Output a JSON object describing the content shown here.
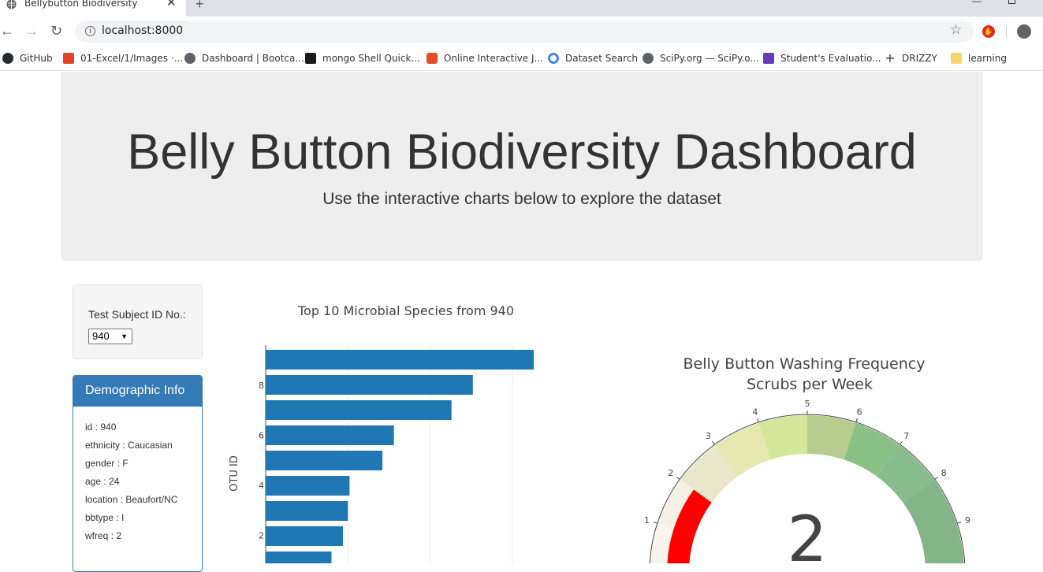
{
  "browser": {
    "tab_title": "Bellybutton Biodiversity",
    "tab_close": "✕",
    "new_tab": "+",
    "url": "localhost:8000",
    "bookmarks": [
      {
        "label": "GitHub",
        "icon": "github-icon",
        "color": "#24292e"
      },
      {
        "label": "01-Excel/1/Images ·...",
        "icon": "gitlab-icon",
        "color": "#e24329"
      },
      {
        "label": "Dashboard | Bootca...",
        "icon": "globe-icon",
        "color": "#5f6368"
      },
      {
        "label": "mongo Shell Quick...",
        "icon": "mongodb-icon",
        "color": "#13aa52"
      },
      {
        "label": "Online Interactive J...",
        "icon": "html5-icon",
        "color": "#e44d26"
      },
      {
        "label": "Dataset Search",
        "icon": "google-icon",
        "color": "#4285f4"
      },
      {
        "label": "SciPy.org — SciPy.o...",
        "icon": "globe-icon",
        "color": "#5f6368"
      },
      {
        "label": "Student's Evaluatio...",
        "icon": "forms-icon",
        "color": "#673ab7"
      },
      {
        "label": "DRIZZY",
        "icon": "plus-icon",
        "color": "#222"
      },
      {
        "label": "learning",
        "icon": "folder-icon",
        "color": "#f6d66b"
      }
    ]
  },
  "header": {
    "title": "Belly Button Biodiversity Dashboard",
    "subtitle": "Use the interactive charts below to explore the dataset"
  },
  "selector": {
    "label": "Test Subject ID No.:",
    "selected": "940",
    "caret": "▼"
  },
  "demographics": {
    "heading": "Demographic Info",
    "rows": [
      "id : 940",
      "ethnicity : Caucasian",
      "gender : F",
      "age : 24",
      "location : Beaufort/NC",
      "bbtype : I",
      "wfreq : 2"
    ]
  },
  "chart_data": [
    {
      "type": "bar",
      "orientation": "horizontal",
      "title": "Top 10 Microbial Species from 940",
      "ylabel": "OTU ID",
      "y_ticks": [
        "2",
        "4",
        "6",
        "8"
      ],
      "y_tick_values": [
        2,
        4,
        6,
        8
      ],
      "values": [
        163,
        126,
        113,
        78,
        71,
        51,
        50,
        47,
        40
      ],
      "x_max": 175,
      "x_gridlines": [
        50,
        100,
        150
      ],
      "color": "#1f77b4",
      "grid": true
    },
    {
      "type": "gauge",
      "title": "Belly Button Washing Frequency",
      "subtitle": "Scrubs per Week",
      "value": 2,
      "range": [
        0,
        10
      ],
      "ticks": [
        "1",
        "2",
        "3",
        "4",
        "5",
        "6",
        "7",
        "8",
        "9"
      ],
      "band_colors": [
        "#f8f3ec",
        "#f4f1e4",
        "#e9e6ca",
        "#e5e8b0",
        "#d5e599",
        "#b7cd8f",
        "#8bc086",
        "#89bc8d",
        "#84b589"
      ],
      "needle_color": "#ff0000"
    }
  ]
}
